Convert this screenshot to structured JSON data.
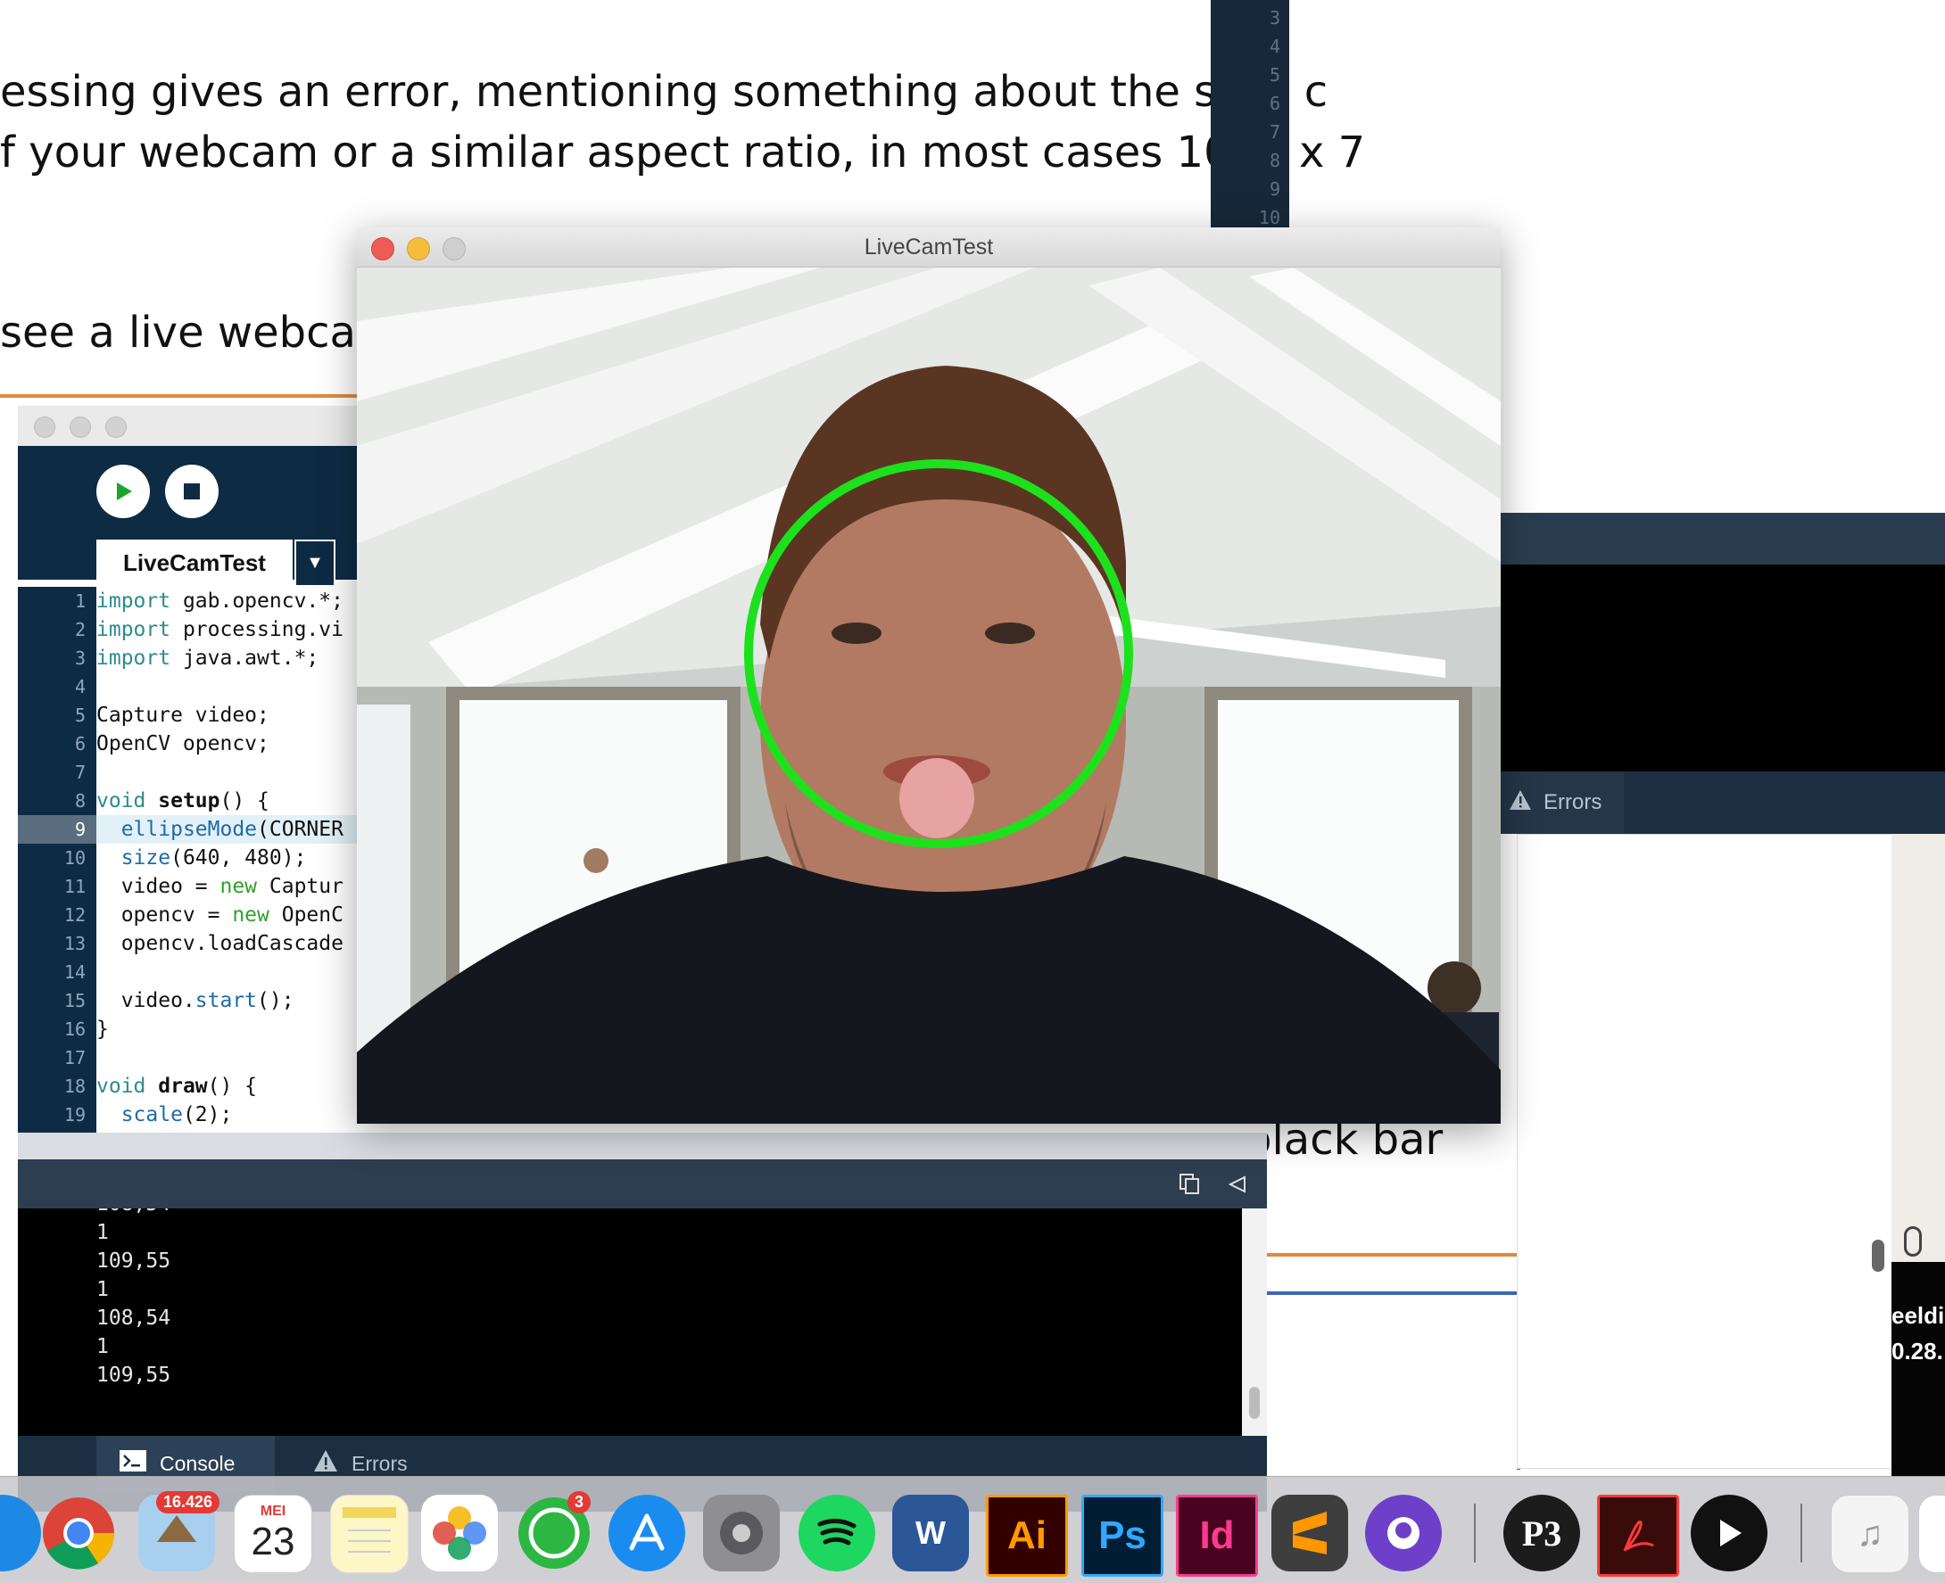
{
  "document": {
    "line1": "essing gives an error, mentioning something about the size, c",
    "line2": "f your webcam or a similar aspect ratio, in most cases 1024 x 7",
    "line3": "see a live webcam",
    "line4": "black bar"
  },
  "top_gutter_numbers": [
    "3",
    "4",
    "5",
    "6",
    "7",
    "8",
    "9",
    "10"
  ],
  "ide": {
    "tab_label": "LiveCamTest",
    "tab_arrow": "▼",
    "line_numbers": [
      "1",
      "2",
      "3",
      "4",
      "5",
      "6",
      "7",
      "8",
      "9",
      "10",
      "11",
      "12",
      "13",
      "14",
      "15",
      "16",
      "17",
      "18",
      "19"
    ],
    "code": {
      "l1a": "import",
      "l1b": " gab.opencv.*;",
      "l2a": "import",
      "l2b": " processing.vi",
      "l3a": "import",
      "l3b": " java.awt.*;",
      "l5": "Capture video;",
      "l6": "OpenCV opencv;",
      "l8a": "void ",
      "l8b": "setup",
      "l8c": "() {",
      "l9a": "  ",
      "l9b": "ellipseMode",
      "l9c": "(CORNER",
      "l10a": "  ",
      "l10b": "size",
      "l10c": "(640, 480);",
      "l11a": "  video = ",
      "l11b": "new",
      "l11c": " Captur",
      "l12a": "  opencv = ",
      "l12b": "new",
      "l12c": " OpenC",
      "l13": "  opencv.loadCascade",
      "l15a": "  video.",
      "l15b": "start",
      "l15c": "();",
      "l16": "}",
      "l18a": "void ",
      "l18b": "draw",
      "l18c": "() {",
      "l19a": "  ",
      "l19b": "scale",
      "l19c": "(2);"
    }
  },
  "console": {
    "lines": [
      "108,54",
      "1",
      "109,55",
      "1",
      "108,54",
      "1",
      "109,55"
    ],
    "tab_console": "Console",
    "tab_errors": "Errors"
  },
  "right_panel": {
    "errors_label": "Errors"
  },
  "video_thumb": {
    "line1": "eeldi",
    "line2": "0.28."
  },
  "sketch": {
    "title": "LiveCamTest",
    "face_circle_color": "#1de11d"
  },
  "dock": {
    "mail_badge": "16.426",
    "calendar_month": "MEI",
    "calendar_day": "23",
    "whatsapp_badge": "3",
    "word_letter": "W",
    "ai_label": "Ai",
    "ps_label": "Ps",
    "id_label": "Id"
  }
}
